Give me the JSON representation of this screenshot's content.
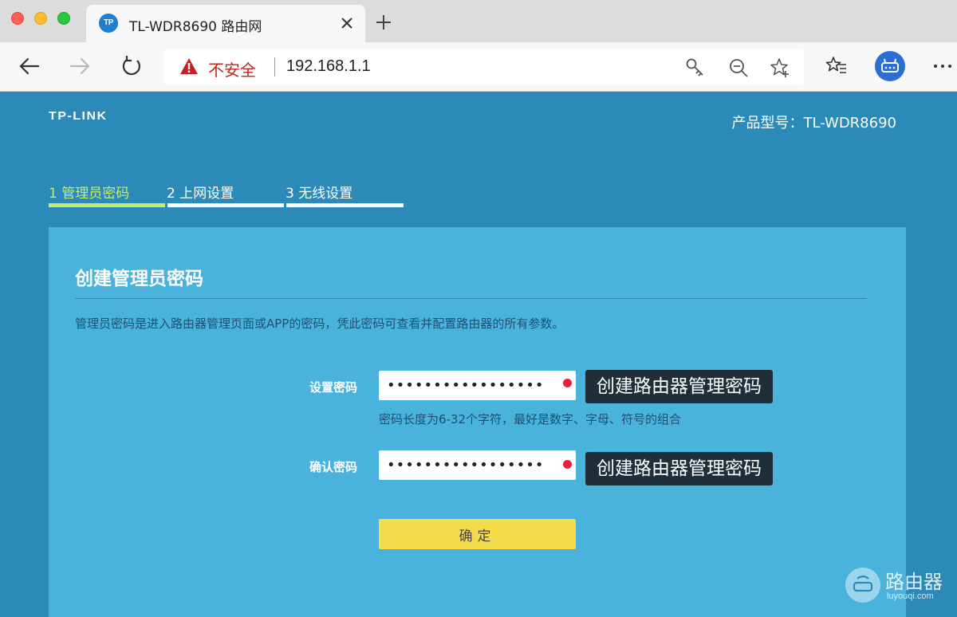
{
  "browser": {
    "tab": {
      "favicon_text": "TP",
      "title": "TL-WDR8690 路由网"
    },
    "address": {
      "security_label": "不安全",
      "url": "192.168.1.1"
    },
    "icons": {
      "back": "arrow-left-icon",
      "forward": "arrow-right-icon",
      "reload": "reload-icon",
      "key": "key-icon",
      "zoom_out": "zoom-out-icon",
      "favorite_add": "star-plus-icon",
      "favorites": "favorites-list-icon",
      "profile": "profile-icon",
      "more": "more-horizontal-icon"
    }
  },
  "header": {
    "logo": "TP-LINK",
    "model": "产品型号：TL-WDR8690"
  },
  "steps": [
    {
      "label": "1 管理员密码",
      "active": true
    },
    {
      "label": "2 上网设置",
      "active": false
    },
    {
      "label": "3 无线设置",
      "active": false
    }
  ],
  "panel": {
    "title": "创建管理员密码",
    "description": "管理员密码是进入路由器管理页面或APP的密码，凭此密码可查看并配置路由器的所有参数。",
    "fields": [
      {
        "label": "设置密码",
        "value": "•••••••••••••••••",
        "tooltip": "创建路由器管理密码"
      },
      {
        "label": "确认密码",
        "value": "•••••••••••••••••",
        "tooltip": "创建路由器管理密码"
      }
    ],
    "hint": "密码长度为6-32个字符，最好是数字、字母、符号的组合",
    "confirm_label": "确定"
  },
  "watermark": {
    "title": "路由器",
    "domain": "luyouqi.com"
  },
  "colors": {
    "page_bg": "#2b8ab8",
    "panel_bg": "#4ab3dc",
    "active_step": "#c6ec6b",
    "confirm_button": "#f4dc4a",
    "required_dot": "#e6223a",
    "tooltip_bg": "#1f2e38"
  }
}
